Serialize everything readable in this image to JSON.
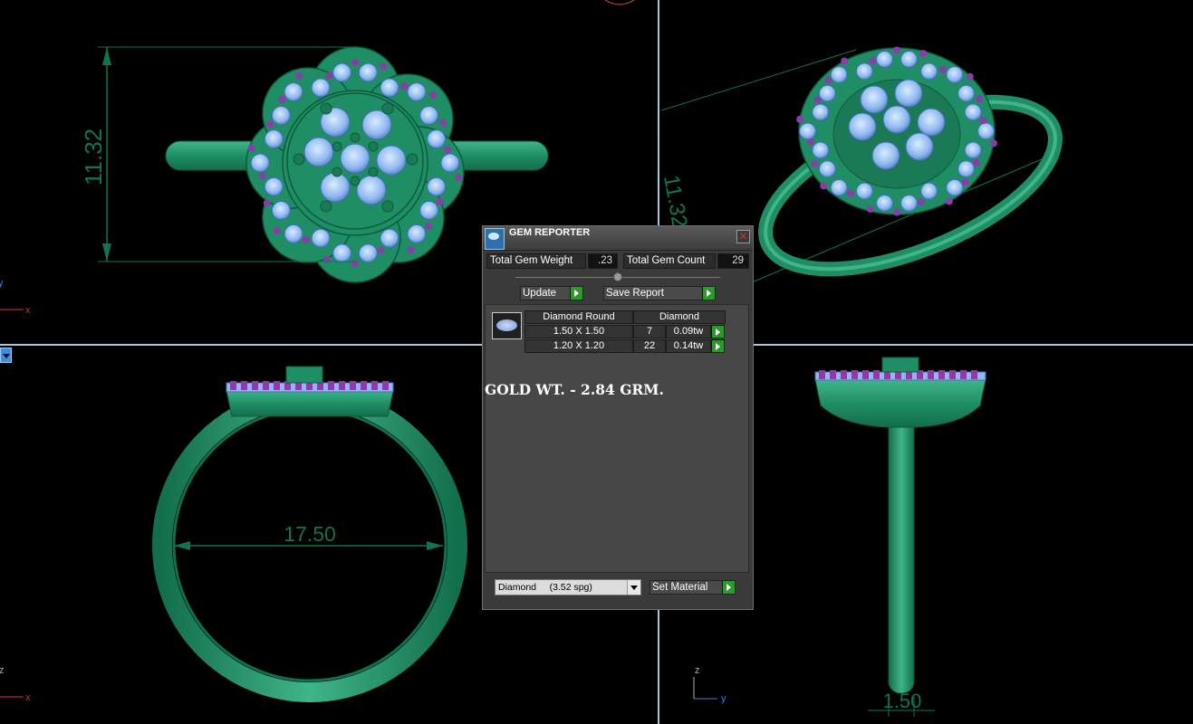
{
  "app": {
    "gem_reporter": {
      "title": "GEM REPORTER",
      "close_glyph": "✕",
      "total_gem_weight_label": "Total Gem Weight",
      "total_gem_weight_value": ".23",
      "total_gem_count_label": "Total Gem Count",
      "total_gem_count_value": "29",
      "update_label": "Update",
      "save_report_label": "Save Report",
      "table": {
        "shape_header": "Diamond Round",
        "material_header": "Diamond",
        "rows": [
          {
            "size": "1.50 X 1.50",
            "count": "7",
            "weight": "0.09tw"
          },
          {
            "size": "1.20 X 1.20",
            "count": "22",
            "weight": "0.14tw"
          }
        ]
      },
      "note": "GOLD WT. - 2.84 GRM.",
      "material_select": "Diamond     (3.52 spg)",
      "set_material_label": "Set Material"
    },
    "viewports": {
      "dim_top_view": "11.32",
      "dim_perspective": "11.32",
      "dim_front_view": "17.50",
      "dim_side_view": "1.50",
      "axis_x": "x",
      "axis_y": "y",
      "axis_z": "z"
    },
    "colors": {
      "metal": "#1f8e64",
      "gem": "#8fb8f0",
      "prong": "#8a3ca8",
      "dimension": "#11744f",
      "viewport_divider": "#a8c8d8",
      "accent_green": "#2c9a2a"
    }
  }
}
